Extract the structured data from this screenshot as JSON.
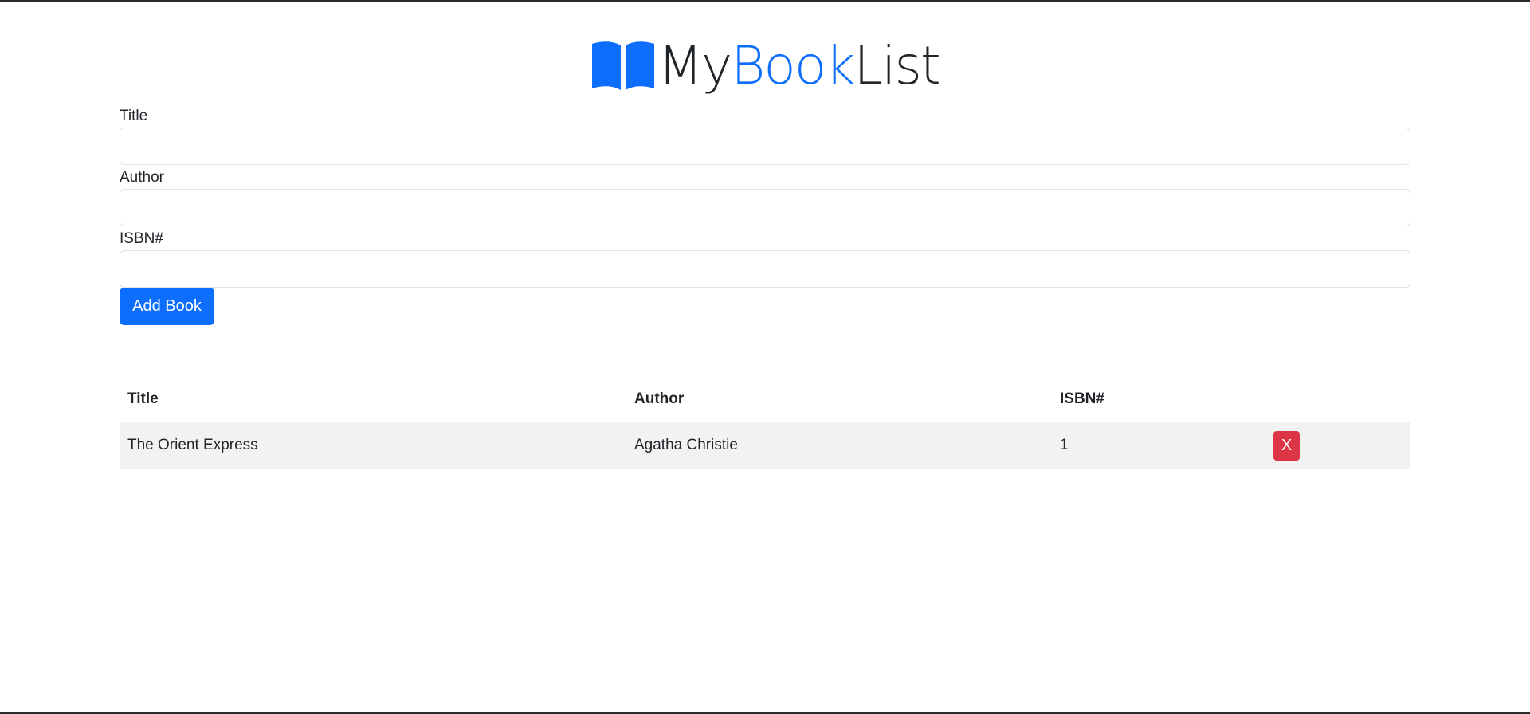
{
  "app": {
    "title_part1": "My",
    "title_part2": "Book",
    "title_part3": "List",
    "icon": "book-open-icon",
    "accent_color": "#0d6efd"
  },
  "form": {
    "title_label": "Title",
    "title_value": "",
    "author_label": "Author",
    "author_value": "",
    "isbn_label": "ISBN#",
    "isbn_value": "",
    "submit_label": "Add Book"
  },
  "table": {
    "headers": [
      "Title",
      "Author",
      "ISBN#"
    ],
    "rows": [
      {
        "title": "The Orient Express",
        "author": "Agatha Christie",
        "isbn": "1",
        "delete_label": "X"
      }
    ],
    "delete_color": "#dc3545"
  }
}
